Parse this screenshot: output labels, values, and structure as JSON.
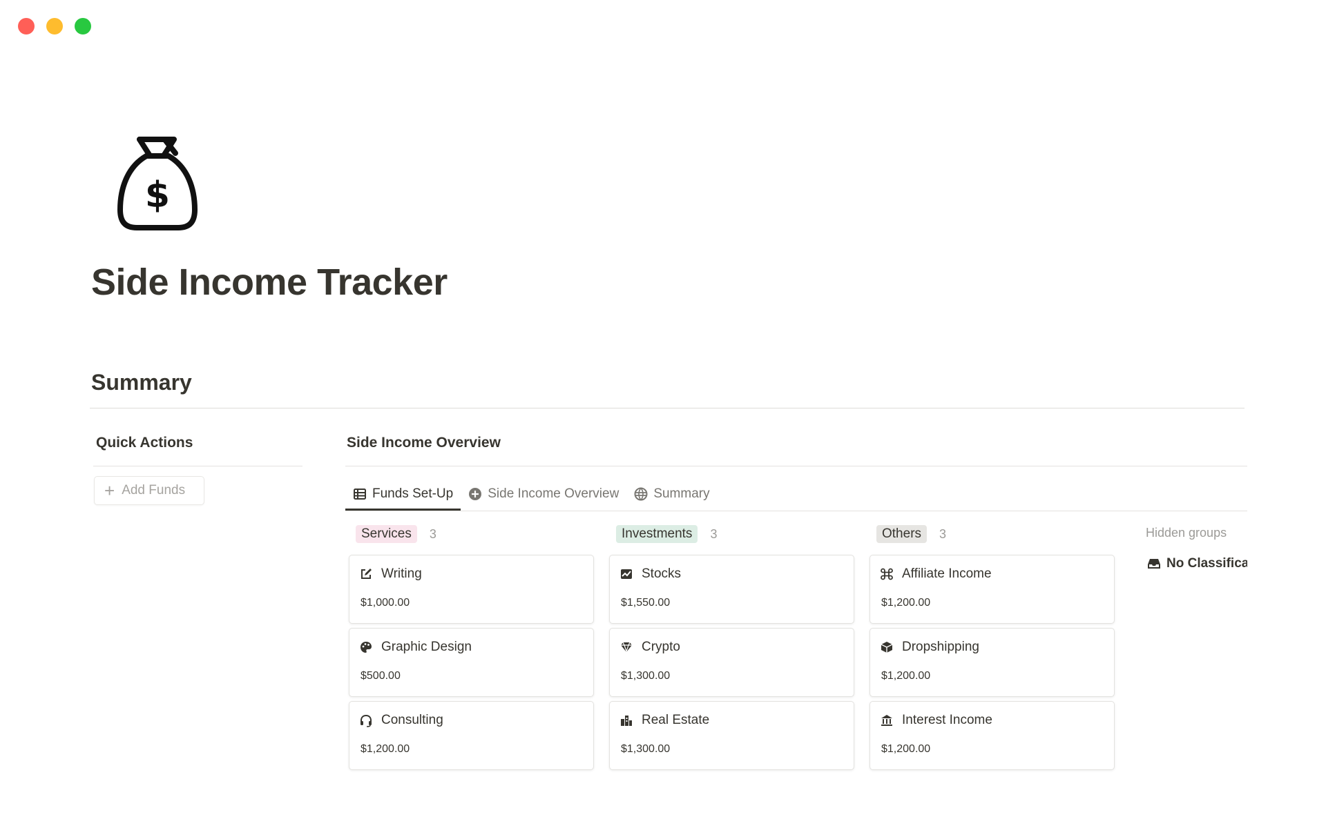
{
  "page": {
    "icon": "money-bag-icon",
    "title": "Side Income Tracker",
    "section_heading": "Summary"
  },
  "quick_actions": {
    "heading": "Quick Actions",
    "add_funds_label": "Add Funds"
  },
  "overview": {
    "heading": "Side Income Overview",
    "tabs": [
      {
        "label": "Funds Set-Up",
        "icon": "table-icon",
        "active": true
      },
      {
        "label": "Side Income Overview",
        "icon": "plus-circle-icon",
        "active": false
      },
      {
        "label": "Summary",
        "icon": "globe-icon",
        "active": false
      }
    ],
    "groups": [
      {
        "name": "Services",
        "count": "3",
        "items": [
          {
            "title": "Writing",
            "amount": "$1,000.00",
            "icon": "edit-icon"
          },
          {
            "title": "Graphic Design",
            "amount": "$500.00",
            "icon": "palette-icon"
          },
          {
            "title": "Consulting",
            "amount": "$1,200.00",
            "icon": "headset-icon"
          }
        ]
      },
      {
        "name": "Investments",
        "count": "3",
        "items": [
          {
            "title": "Stocks",
            "amount": "$1,550.00",
            "icon": "chart-icon"
          },
          {
            "title": "Crypto",
            "amount": "$1,300.00",
            "icon": "gem-icon"
          },
          {
            "title": "Real Estate",
            "amount": "$1,300.00",
            "icon": "city-icon"
          }
        ]
      },
      {
        "name": "Others",
        "count": "3",
        "items": [
          {
            "title": "Affiliate Income",
            "amount": "$1,200.00",
            "icon": "command-icon"
          },
          {
            "title": "Dropshipping",
            "amount": "$1,200.00",
            "icon": "box-icon"
          },
          {
            "title": "Interest Income",
            "amount": "$1,200.00",
            "icon": "bank-icon"
          }
        ]
      }
    ],
    "hidden_groups_label": "Hidden groups",
    "hidden_group_item": "No Classifica"
  },
  "colors": {
    "services_tag": "#f9e4ec",
    "investments_tag": "#dcede4",
    "others_tag": "#e6e5e2",
    "text": "#37352f",
    "muted": "#9b9a97"
  }
}
